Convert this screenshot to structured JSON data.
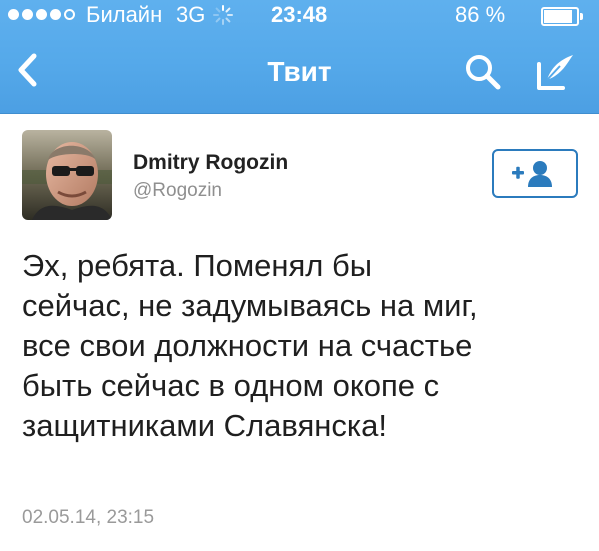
{
  "status_bar": {
    "signal_dots_filled": 4,
    "signal_dots_total": 5,
    "carrier": "Билайн",
    "network": "3G",
    "time": "23:48",
    "battery_percent": "86 %",
    "battery_level": 0.86
  },
  "nav": {
    "title": "Твит",
    "back_icon": "chevron-left-icon",
    "search_icon": "search-icon",
    "compose_icon": "compose-icon"
  },
  "tweet": {
    "author_name": "Dmitry Rogozin",
    "author_handle": "@Rogozin",
    "text_lines": [
      "Эх, ребята.  Поменял бы",
      "сейчас, не задумываясь на миг,",
      "все свои должности на счастье",
      "быть сейчас в одном окопе с",
      "защитниками Славянска!"
    ],
    "timestamp": "02.05.14, 23:15"
  },
  "colors": {
    "nav_bar": "#55a9ea",
    "follow_button_border": "#2b7bbd",
    "text_primary": "#1f1f1f",
    "text_secondary": "#9a9a9a"
  }
}
